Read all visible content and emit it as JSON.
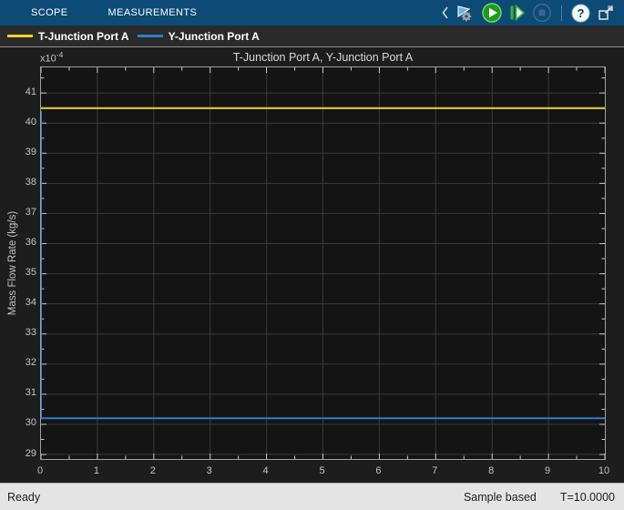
{
  "colors": {
    "toolstrip_blue": "#0d4a75",
    "panel_dark": "#1d1d1d",
    "axes_bg": "#141414",
    "grid": "#3a3a3a",
    "tick": "#c9c9c9",
    "run_green": "#1d9b1d",
    "series_yellow": "#f4d22b",
    "series_blue": "#2f7fca"
  },
  "toolbar": {
    "tabs": [
      {
        "label": "SCOPE"
      },
      {
        "label": "MEASUREMENTS"
      }
    ],
    "icons": [
      "collapse-chevron-icon",
      "scope-settings-icon",
      "run-icon",
      "step-forward-icon",
      "stop-icon",
      "help-icon",
      "popout-icon"
    ],
    "help_glyph": "?"
  },
  "legend": {
    "items": [
      {
        "label": "T-Junction Port A",
        "color": "#f4d22b"
      },
      {
        "label": "Y-Junction Port A",
        "color": "#2f7fca"
      }
    ]
  },
  "chart_data": {
    "type": "line",
    "title": "T-Junction Port A, Y-Junction Port A",
    "ylabel": "Mass Flow Rate (kg/s)",
    "xlabel": "",
    "y_multiplier": {
      "base": "x10",
      "exp": "-4"
    },
    "y_units": "×10⁻⁴ kg/s",
    "xlim": [
      0,
      10
    ],
    "ylim": [
      28.85,
      41.85
    ],
    "xticks": [
      0,
      1,
      2,
      3,
      4,
      5,
      6,
      7,
      8,
      9,
      10
    ],
    "yticks": [
      29,
      30,
      31,
      32,
      33,
      34,
      35,
      36,
      37,
      38,
      39,
      40,
      41
    ],
    "minor_tick_step": 0.5,
    "grid": true,
    "legend_position": "top-strip",
    "series": [
      {
        "name": "T-Junction Port A",
        "color": "#f4d22b",
        "x": [
          0,
          10
        ],
        "y": [
          40.5,
          40.5
        ]
      },
      {
        "name": "Y-Junction Port A",
        "color": "#2f7fca",
        "x": [
          0,
          0,
          10
        ],
        "y": [
          40.4,
          30.2,
          30.2
        ]
      }
    ]
  },
  "statusbar": {
    "ready": "Ready",
    "sample_mode": "Sample based",
    "time": "T=10.0000"
  }
}
